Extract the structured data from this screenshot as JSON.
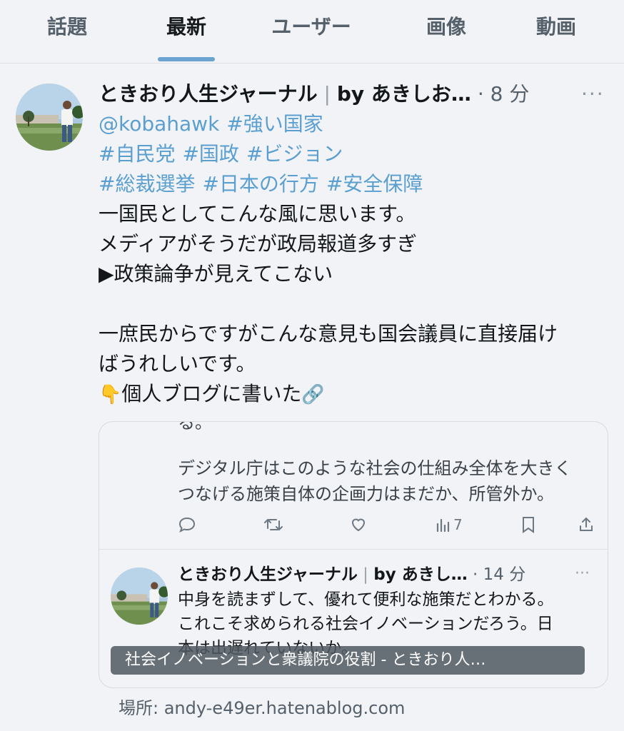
{
  "tabs": [
    {
      "label": "話題"
    },
    {
      "label": "最新"
    },
    {
      "label": "ユーザー"
    },
    {
      "label": "画像"
    },
    {
      "label": "動画"
    }
  ],
  "active_tab": "最新",
  "tweet": {
    "author": "ときおり人生ジャーナル",
    "separator": "|",
    "by": "by あきしお…",
    "dot": "·",
    "time": "8 分",
    "more": "···",
    "mention": "@kobahawk",
    "hashtag_lines": [
      [
        "#強い国家"
      ],
      [
        "#自民党",
        "#国政",
        "#ビジョン"
      ],
      [
        "#総裁選挙",
        "#日本の行方",
        "#安全保障"
      ]
    ],
    "body_lines": [
      "一国民としてこんな風に思います。",
      "メディアがそうだが政局報道多すぎ",
      "▶政策論争が見えてこない",
      "",
      "一庶民からですがこんな意見も国会議員に直接届け",
      "ばうれしいです。",
      "個人ブログに書いた"
    ],
    "emoji_point": "👇",
    "emoji_link": "🔗"
  },
  "card": {
    "cut_line": "る。",
    "text_lines": [
      "デジタル庁はこのような社会の仕組み全体を大きく",
      "つなげる施策自体の企画力はまだか、所管外か。"
    ],
    "actions": {
      "views": "7"
    },
    "reply": {
      "author": "ときおり人生ジャーナル",
      "separator": "|",
      "by": "by あきし…",
      "dot": "·",
      "time": "14 分",
      "more": "···",
      "lines": [
        "中身を読まずして、優れて便利な施策だとわかる。",
        "これこそ求められる社会イノベーションだろう。日",
        "本は出遅れていないか。"
      ]
    },
    "caption": "社会イノベーションと衆議院の役割 - ときおり人…"
  },
  "location": "場所: andy-e49er.hatenablog.com",
  "colors": {
    "accent": "#5b9fd0",
    "tab_indicator": "#6aa2d0",
    "background": "#f1f3f6"
  }
}
